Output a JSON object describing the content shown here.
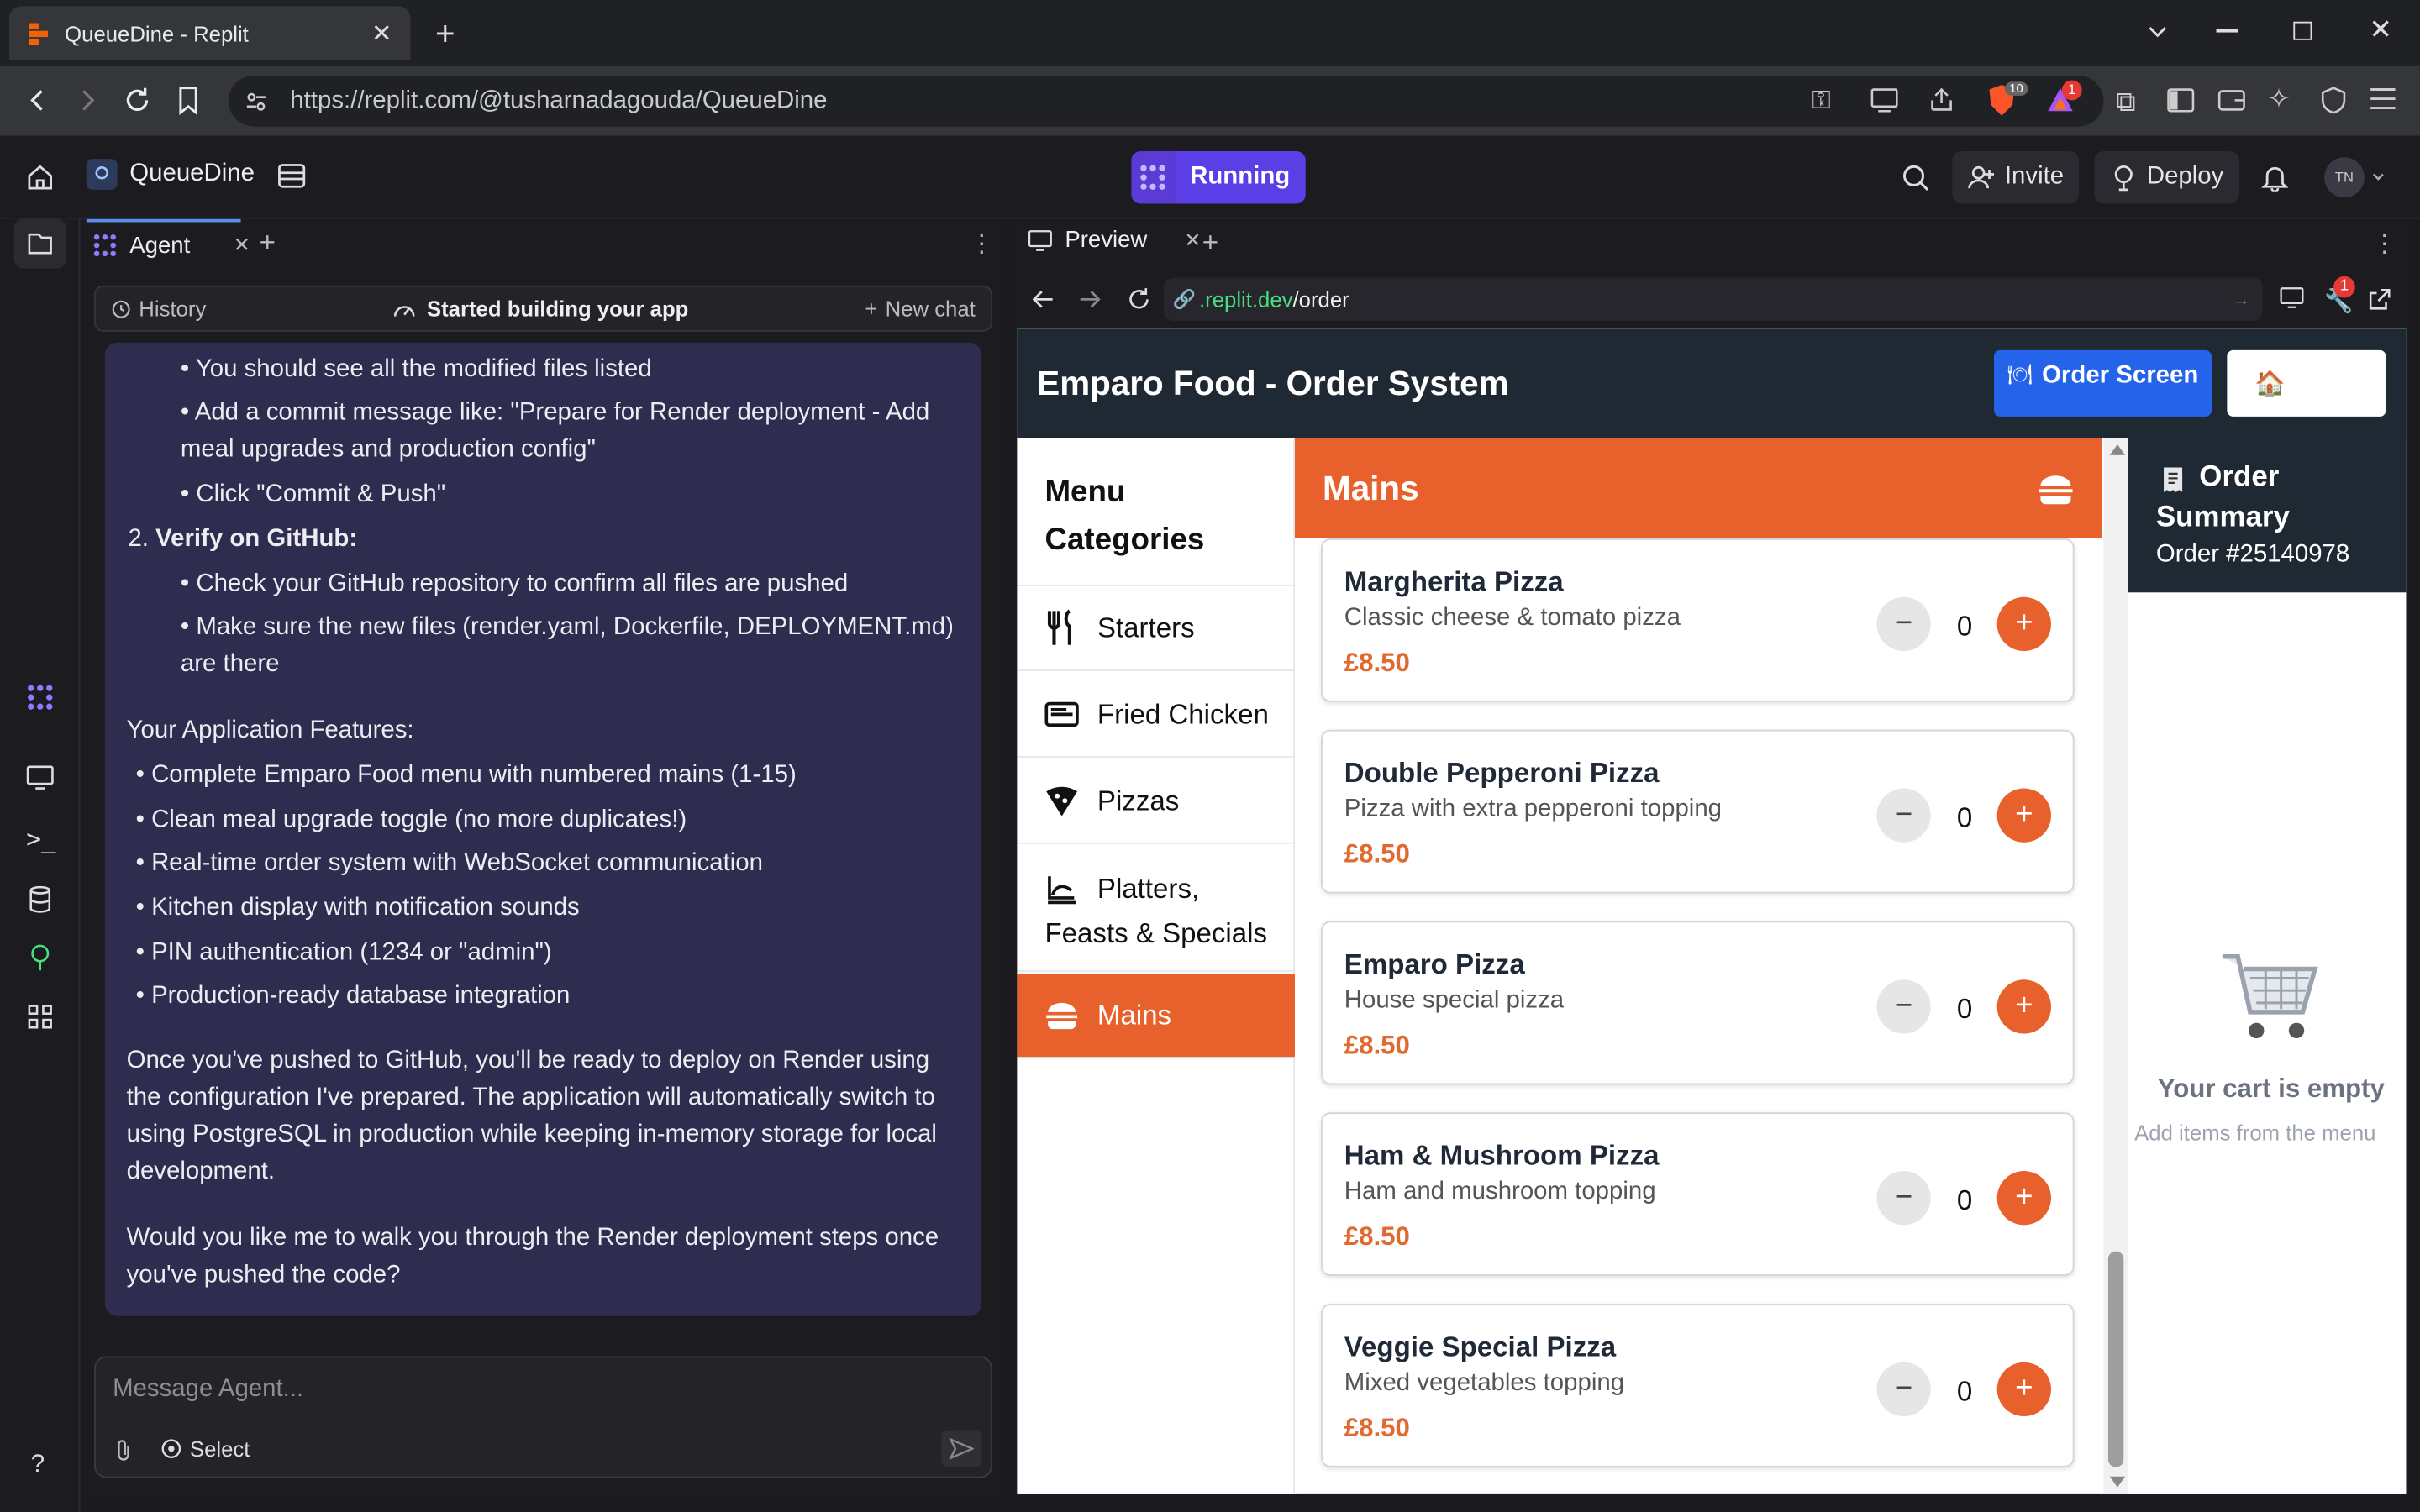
{
  "browser": {
    "tab_title": "QueueDine - Replit",
    "url": "https://replit.com/@tusharnadagouda/QueueDine",
    "brave_badge": "10",
    "alert_badge": "1"
  },
  "replit": {
    "project_name": "QueueDine",
    "run_status": "Running",
    "invite_label": "Invite",
    "deploy_label": "Deploy",
    "avatar_initials": "TN"
  },
  "agent": {
    "tab_label": "Agent",
    "history_label": "History",
    "status_text": "Started building your app",
    "new_chat_label": "New chat",
    "message_placeholder": "Message Agent...",
    "select_label": "Select",
    "messages": {
      "b1": "You should see all the modified files listed",
      "b2": "Add a commit message like: \"Prepare for Render deployment - Add meal upgrades and production config\"",
      "b3": "Click \"Commit & Push\"",
      "step2_num": "2.",
      "step2": "Verify on GitHub:",
      "b4": "Check your GitHub repository to confirm all files are pushed",
      "b5": "Make sure the new files (render.yaml, Dockerfile, DEPLOYMENT.md) are there",
      "features_title": "Your Application Features:",
      "f1": "Complete Emparo Food menu with numbered mains (1-15)",
      "f2": "Clean meal upgrade toggle (no more duplicates!)",
      "f3": "Real-time order system with WebSocket communication",
      "f4": "Kitchen display with notification sounds",
      "f5": "PIN authentication (1234 or \"admin\")",
      "f6": "Production-ready database integration",
      "para1": "Once you've pushed to GitHub, you'll be ready to deploy on Render using the configuration I've prepared. The application will automatically switch to using PostgreSQL in production while keeping in-memory storage for local development.",
      "para2": "Would you like me to walk you through the Render deployment steps once you've pushed the code?"
    }
  },
  "preview": {
    "tab_label": "Preview",
    "url_domain": ".replit.dev",
    "url_path": "/order",
    "badge": "1"
  },
  "app": {
    "title": "Emparo Food - Order System",
    "order_screen_label": "Order Screen",
    "home_icon_glyph": "🏠",
    "categories_title": "Menu Categories",
    "categories": [
      {
        "label": "Starters",
        "icon": "utensils-icon"
      },
      {
        "label": "Fried Chicken",
        "icon": "chicken-icon"
      },
      {
        "label": "Pizzas",
        "icon": "pizza-icon"
      },
      {
        "label": "Platters, Feasts & Specials",
        "icon": "platter-icon"
      },
      {
        "label": "Mains",
        "icon": "burger-icon"
      }
    ],
    "section_title": "Mains",
    "items": [
      {
        "name": "Margherita Pizza",
        "desc": "Classic cheese & tomato pizza",
        "price": "£8.50",
        "qty": "0"
      },
      {
        "name": "Double Pepperoni Pizza",
        "desc": "Pizza with extra pepperoni topping",
        "price": "£8.50",
        "qty": "0"
      },
      {
        "name": "Emparo Pizza",
        "desc": "House special pizza",
        "price": "£8.50",
        "qty": "0"
      },
      {
        "name": "Ham & Mushroom Pizza",
        "desc": "Ham and mushroom topping",
        "price": "£8.50",
        "qty": "0"
      },
      {
        "name": "Veggie Special Pizza",
        "desc": "Mixed vegetables topping",
        "price": "£8.50",
        "qty": "0"
      }
    ],
    "order_summary_title": "Order Summary",
    "order_number": "Order #25140978",
    "empty_cart_title": "Your cart is empty",
    "empty_cart_sub": "Add items from the menu",
    "colors": {
      "accent": "#e8612c",
      "header": "#1f2933",
      "blue": "#2563eb"
    }
  }
}
